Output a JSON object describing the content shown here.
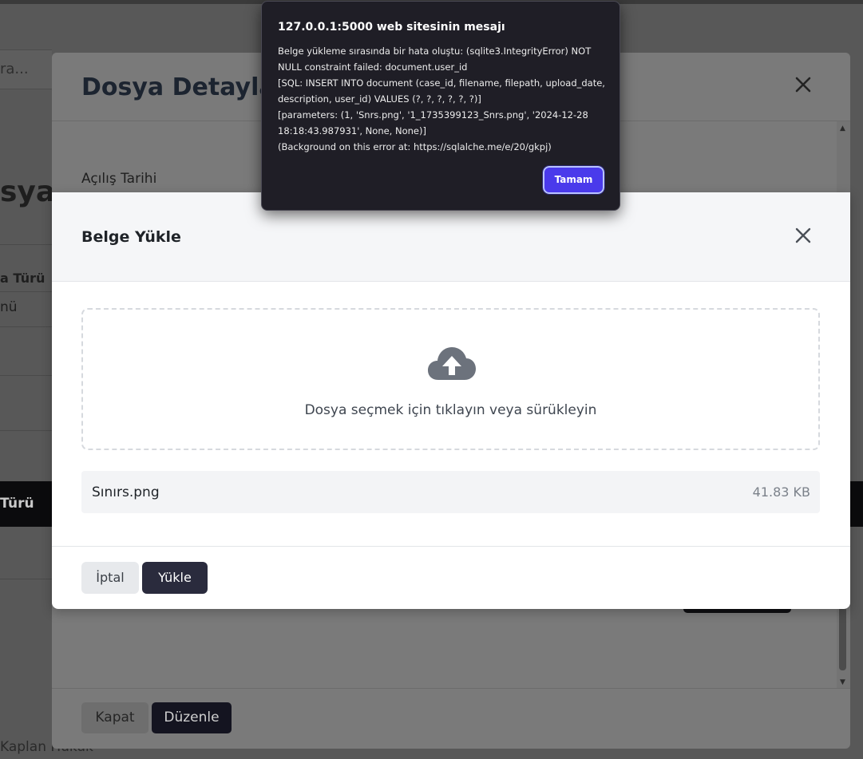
{
  "background_page": {
    "search_placeholder": "ra...",
    "title_fragment": "sya",
    "column_header_fragment": "a Türü",
    "row_fragment": "nü",
    "dark_bar_fragment": "Türü",
    "footer_fragment": "Kaplan Hukuk"
  },
  "back_modal": {
    "title": "Dosya Detayları",
    "field_label": "Açılış Tarihi",
    "close_icon": "close-icon",
    "buttons": {
      "close_label": "Kapat",
      "edit_label": "Düzenle"
    }
  },
  "upload_modal": {
    "title": "Belge Yükle",
    "close_icon": "close-icon",
    "dropzone": {
      "icon": "cloud-upload-icon",
      "text": "Dosya seçmek için tıklayın veya sürükleyin"
    },
    "selected_file": {
      "name": "Sınırs.png",
      "size": "41.83 KB"
    },
    "buttons": {
      "cancel_label": "İptal",
      "upload_label": "Yükle"
    }
  },
  "alert": {
    "title": "127.0.0.1:5000 web sitesinin mesajı",
    "message": "Belge yükleme sırasında bir hata oluştu: (sqlite3.IntegrityError) NOT NULL constraint failed: document.user_id\n[SQL: INSERT INTO document (case_id, filename, filepath, upload_date, description, user_id) VALUES (?, ?, ?, ?, ?, ?)]\n[parameters: (1, 'Snrs.png', '1_1735399123_Snrs.png', '2024-12-28 18:18:43.987931', None, None)]\n(Background on this error at: https://sqlalche.me/e/20/gkpj)",
    "ok_label": "Tamam"
  },
  "colors": {
    "accent": "#4a3aeb",
    "primary_button": "#2a2b3d",
    "alert_background": "#1f1e26"
  }
}
